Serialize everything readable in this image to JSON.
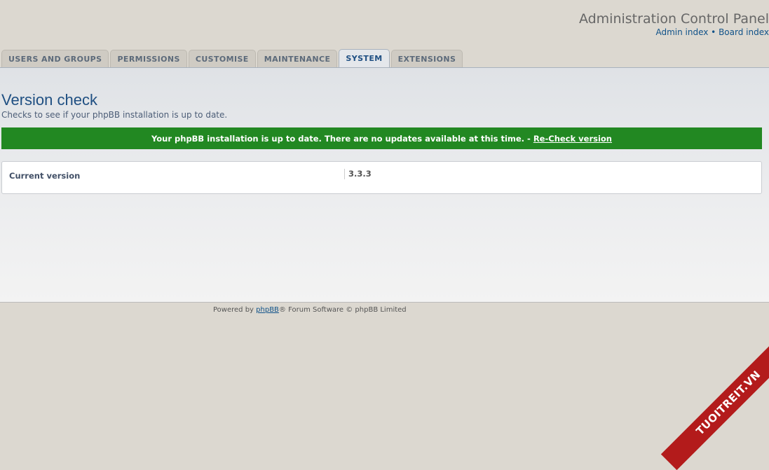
{
  "header": {
    "title": "Administration Control Panel",
    "links": [
      {
        "label": "Admin index"
      },
      {
        "label": "Board index"
      }
    ],
    "separator": "•"
  },
  "tabs": [
    {
      "label": "USERS AND GROUPS",
      "active": false
    },
    {
      "label": "PERMISSIONS",
      "active": false
    },
    {
      "label": "CUSTOMISE",
      "active": false
    },
    {
      "label": "MAINTENANCE",
      "active": false
    },
    {
      "label": "SYSTEM",
      "active": true
    },
    {
      "label": "EXTENSIONS",
      "active": false
    }
  ],
  "page": {
    "title": "Version check",
    "description": "Checks to see if your phpBB installation is up to date."
  },
  "success": {
    "message": "Your phpBB installation is up to date. There are no updates available at this time. -",
    "recheck_label": "Re-Check version",
    "color": "#228822"
  },
  "version": {
    "label": "Current version",
    "value": "3.3.3"
  },
  "footer": {
    "prefix": "Powered by",
    "link": "phpBB",
    "suffix": "® Forum Software © phpBB Limited"
  },
  "watermark": {
    "text": "TUOITREIT.VN",
    "color": "#b31b1b"
  }
}
